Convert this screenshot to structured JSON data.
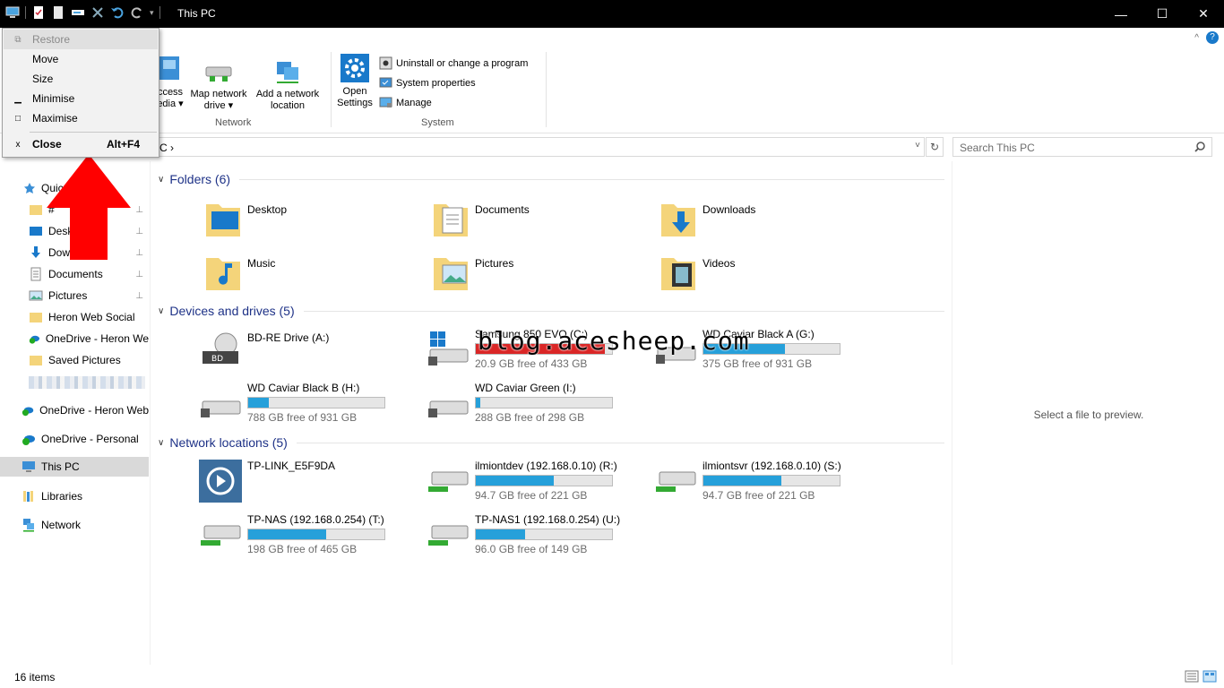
{
  "window": {
    "title": "This PC",
    "controls": {
      "minimize": "—",
      "maximize": "☐",
      "close": "✕"
    }
  },
  "system_menu": {
    "items": [
      {
        "label": "Restore",
        "glyph": "⧉",
        "disabled": true
      },
      {
        "label": "Move",
        "glyph": ""
      },
      {
        "label": "Size",
        "glyph": ""
      },
      {
        "label": "Minimise",
        "glyph": "▁"
      },
      {
        "label": "Maximise",
        "glyph": "□"
      },
      {
        "label": "Close",
        "glyph": "x",
        "accelerator": "Alt+F4"
      }
    ]
  },
  "ribbon": {
    "network": {
      "label": "Network",
      "access_media_1": "ccess",
      "access_media_2": "edia ▾",
      "map_drive_1": "Map network",
      "map_drive_2": "drive ▾",
      "add_location_1": "Add a network",
      "add_location_2": "location"
    },
    "system": {
      "label": "System",
      "open_settings_1": "Open",
      "open_settings_2": "Settings",
      "uninstall": "Uninstall or change a program",
      "properties": "System properties",
      "manage": "Manage"
    },
    "collapse_glyph": "^",
    "help_glyph": "?"
  },
  "address": {
    "path": "C  ›",
    "dropdown": "˅",
    "refresh": "↻"
  },
  "search": {
    "placeholder": "Search This PC"
  },
  "nav": {
    "quick_access": "Quic",
    "items": [
      {
        "label": "#",
        "pinned": true
      },
      {
        "label": "Desk",
        "pinned": true
      },
      {
        "label": "Dow",
        "pinned": true
      },
      {
        "label": "Documents",
        "pinned": true
      },
      {
        "label": "Pictures",
        "pinned": true
      },
      {
        "label": "Heron Web Social"
      },
      {
        "label": "OneDrive - Heron We"
      },
      {
        "label": "Saved Pictures"
      }
    ],
    "roots": [
      {
        "label": "OneDrive - Heron Web"
      },
      {
        "label": "OneDrive - Personal"
      },
      {
        "label": "This PC"
      },
      {
        "label": "Libraries"
      },
      {
        "label": "Network"
      }
    ],
    "pin_glyph": "📌"
  },
  "content": {
    "folders": {
      "header": "Folders (6)",
      "items": [
        "Desktop",
        "Documents",
        "Downloads",
        "Music",
        "Pictures",
        "Videos"
      ]
    },
    "devices": {
      "header": "Devices and drives (5)",
      "items": [
        {
          "name": "BD-RE Drive (A:)",
          "free": "",
          "fill": null
        },
        {
          "name": "Samsung 850 EVO (C:)",
          "free": "20.9 GB free of 433 GB",
          "fill": 0.95,
          "warn": true
        },
        {
          "name": "WD Caviar Black A (G:)",
          "free": "375 GB free of 931 GB",
          "fill": 0.6
        },
        {
          "name": "WD Caviar Black B (H:)",
          "free": "788 GB free of 931 GB",
          "fill": 0.15
        },
        {
          "name": "WD Caviar Green (I:)",
          "free": "288 GB free of 298 GB",
          "fill": 0.03
        }
      ]
    },
    "network": {
      "header": "Network locations (5)",
      "items": [
        {
          "name": "TP-LINK_E5F9DA",
          "free": "",
          "fill": null
        },
        {
          "name": "ilmiontdev (192.168.0.10) (R:)",
          "free": "94.7 GB free of 221 GB",
          "fill": 0.57
        },
        {
          "name": "ilmiontsvr (192.168.0.10) (S:)",
          "free": "94.7 GB free of 221 GB",
          "fill": 0.57
        },
        {
          "name": "TP-NAS (192.168.0.254) (T:)",
          "free": "198 GB free of 465 GB",
          "fill": 0.57
        },
        {
          "name": "TP-NAS1 (192.168.0.254) (U:)",
          "free": "96.0 GB free of 149 GB",
          "fill": 0.36
        }
      ]
    }
  },
  "preview": {
    "text": "Select a file to preview."
  },
  "status": {
    "count": "16 items"
  },
  "watermark": "blog.acesheep.com",
  "colors": {
    "accent": "#1e3287",
    "bar": "#26a0da",
    "bar_warn": "#da2626",
    "arrow": "#ff0000"
  }
}
